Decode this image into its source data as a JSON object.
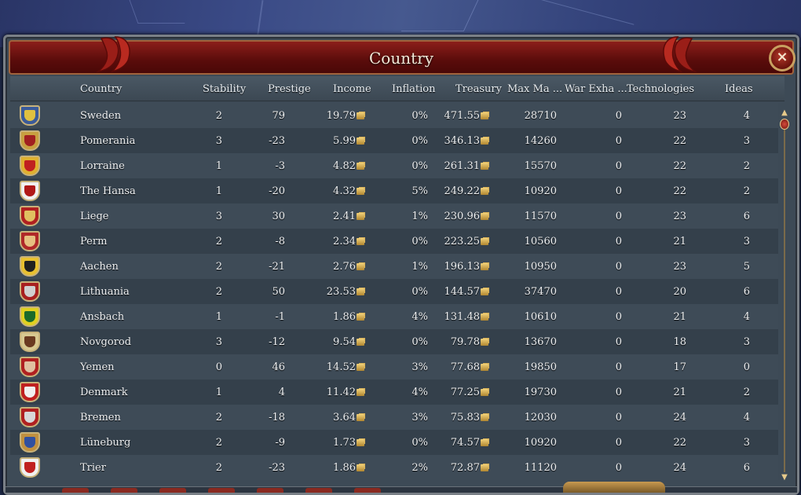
{
  "window": {
    "title": "Country",
    "close_icon": "×"
  },
  "columns": {
    "country": "Country",
    "stability": "Stability",
    "prestige": "Prestige",
    "income": "Income",
    "inflation": "Inflation",
    "treasury": "Treasury",
    "max_manpower": "Max Ma ...",
    "war_exhaustion": "War Exha ...",
    "technologies": "Technologies",
    "ideas": "Ideas"
  },
  "rows": [
    {
      "country": "Sweden",
      "stability": "2",
      "prestige": "79",
      "income": "19.79",
      "inflation": "0%",
      "treasury": "471.55",
      "max_manpower": "28710",
      "war_exhaustion": "0",
      "technologies": "23",
      "ideas": "4",
      "flag_color": "#3a5a9a",
      "flag_accent": "#e0c040"
    },
    {
      "country": "Pomerania",
      "stability": "3",
      "prestige": "-23",
      "income": "5.99",
      "inflation": "0%",
      "treasury": "346.13",
      "max_manpower": "14260",
      "war_exhaustion": "0",
      "technologies": "22",
      "ideas": "3",
      "flag_color": "#c8a040",
      "flag_accent": "#a02020"
    },
    {
      "country": "Lorraine",
      "stability": "1",
      "prestige": "-3",
      "income": "4.82",
      "inflation": "0%",
      "treasury": "261.31",
      "max_manpower": "15570",
      "war_exhaustion": "0",
      "technologies": "22",
      "ideas": "2",
      "flag_color": "#e0b030",
      "flag_accent": "#c02020"
    },
    {
      "country": "The Hansa",
      "stability": "1",
      "prestige": "-20",
      "income": "4.32",
      "inflation": "5%",
      "treasury": "249.22",
      "max_manpower": "10920",
      "war_exhaustion": "0",
      "technologies": "22",
      "ideas": "2",
      "flag_color": "#f0f0f0",
      "flag_accent": "#b01818"
    },
    {
      "country": "Liege",
      "stability": "3",
      "prestige": "30",
      "income": "2.41",
      "inflation": "1%",
      "treasury": "230.96",
      "max_manpower": "11570",
      "war_exhaustion": "0",
      "technologies": "23",
      "ideas": "6",
      "flag_color": "#b02020",
      "flag_accent": "#e0c060"
    },
    {
      "country": "Perm",
      "stability": "2",
      "prestige": "-8",
      "income": "2.34",
      "inflation": "0%",
      "treasury": "223.25",
      "max_manpower": "10560",
      "war_exhaustion": "0",
      "technologies": "21",
      "ideas": "3",
      "flag_color": "#b02828",
      "flag_accent": "#e6c080"
    },
    {
      "country": "Aachen",
      "stability": "2",
      "prestige": "-21",
      "income": "2.76",
      "inflation": "1%",
      "treasury": "196.13",
      "max_manpower": "10950",
      "war_exhaustion": "0",
      "technologies": "23",
      "ideas": "5",
      "flag_color": "#e8c030",
      "flag_accent": "#202020"
    },
    {
      "country": "Lithuania",
      "stability": "2",
      "prestige": "50",
      "income": "23.53",
      "inflation": "0%",
      "treasury": "144.57",
      "max_manpower": "37470",
      "war_exhaustion": "0",
      "technologies": "20",
      "ideas": "6",
      "flag_color": "#a82020",
      "flag_accent": "#d0d0d0"
    },
    {
      "country": "Ansbach",
      "stability": "1",
      "prestige": "-1",
      "income": "1.86",
      "inflation": "4%",
      "treasury": "131.48",
      "max_manpower": "10610",
      "war_exhaustion": "0",
      "technologies": "21",
      "ideas": "4",
      "flag_color": "#e0d020",
      "flag_accent": "#1a6a2a"
    },
    {
      "country": "Novgorod",
      "stability": "3",
      "prestige": "-12",
      "income": "9.54",
      "inflation": "0%",
      "treasury": "79.78",
      "max_manpower": "13670",
      "war_exhaustion": "0",
      "technologies": "18",
      "ideas": "3",
      "flag_color": "#d8c890",
      "flag_accent": "#6a3a20"
    },
    {
      "country": "Yemen",
      "stability": "0",
      "prestige": "46",
      "income": "14.52",
      "inflation": "3%",
      "treasury": "77.68",
      "max_manpower": "19850",
      "war_exhaustion": "0",
      "technologies": "17",
      "ideas": "0",
      "flag_color": "#b02020",
      "flag_accent": "#e0c0a0"
    },
    {
      "country": "Denmark",
      "stability": "1",
      "prestige": "4",
      "income": "11.42",
      "inflation": "4%",
      "treasury": "77.25",
      "max_manpower": "19730",
      "war_exhaustion": "0",
      "technologies": "21",
      "ideas": "2",
      "flag_color": "#c02020",
      "flag_accent": "#f0f0f0"
    },
    {
      "country": "Bremen",
      "stability": "2",
      "prestige": "-18",
      "income": "3.64",
      "inflation": "3%",
      "treasury": "75.83",
      "max_manpower": "12030",
      "war_exhaustion": "0",
      "technologies": "24",
      "ideas": "4",
      "flag_color": "#b02020",
      "flag_accent": "#d8d8d8"
    },
    {
      "country": "Lüneburg",
      "stability": "2",
      "prestige": "-9",
      "income": "1.73",
      "inflation": "0%",
      "treasury": "74.57",
      "max_manpower": "10920",
      "war_exhaustion": "0",
      "technologies": "22",
      "ideas": "3",
      "flag_color": "#c09040",
      "flag_accent": "#3050a0"
    },
    {
      "country": "Trier",
      "stability": "2",
      "prestige": "-23",
      "income": "1.86",
      "inflation": "2%",
      "treasury": "72.87",
      "max_manpower": "11120",
      "war_exhaustion": "0",
      "technologies": "24",
      "ideas": "6",
      "flag_color": "#f0f0f0",
      "flag_accent": "#c02020"
    }
  ],
  "scrollbar": {
    "up_icon": "▲",
    "down_icon": "▼"
  },
  "colors": {
    "title_bar": "#7a1a16",
    "row_odd": "#3e4b57",
    "row_even": "#34404b",
    "text": "#eef0f2",
    "gold": "#d9b35a"
  }
}
